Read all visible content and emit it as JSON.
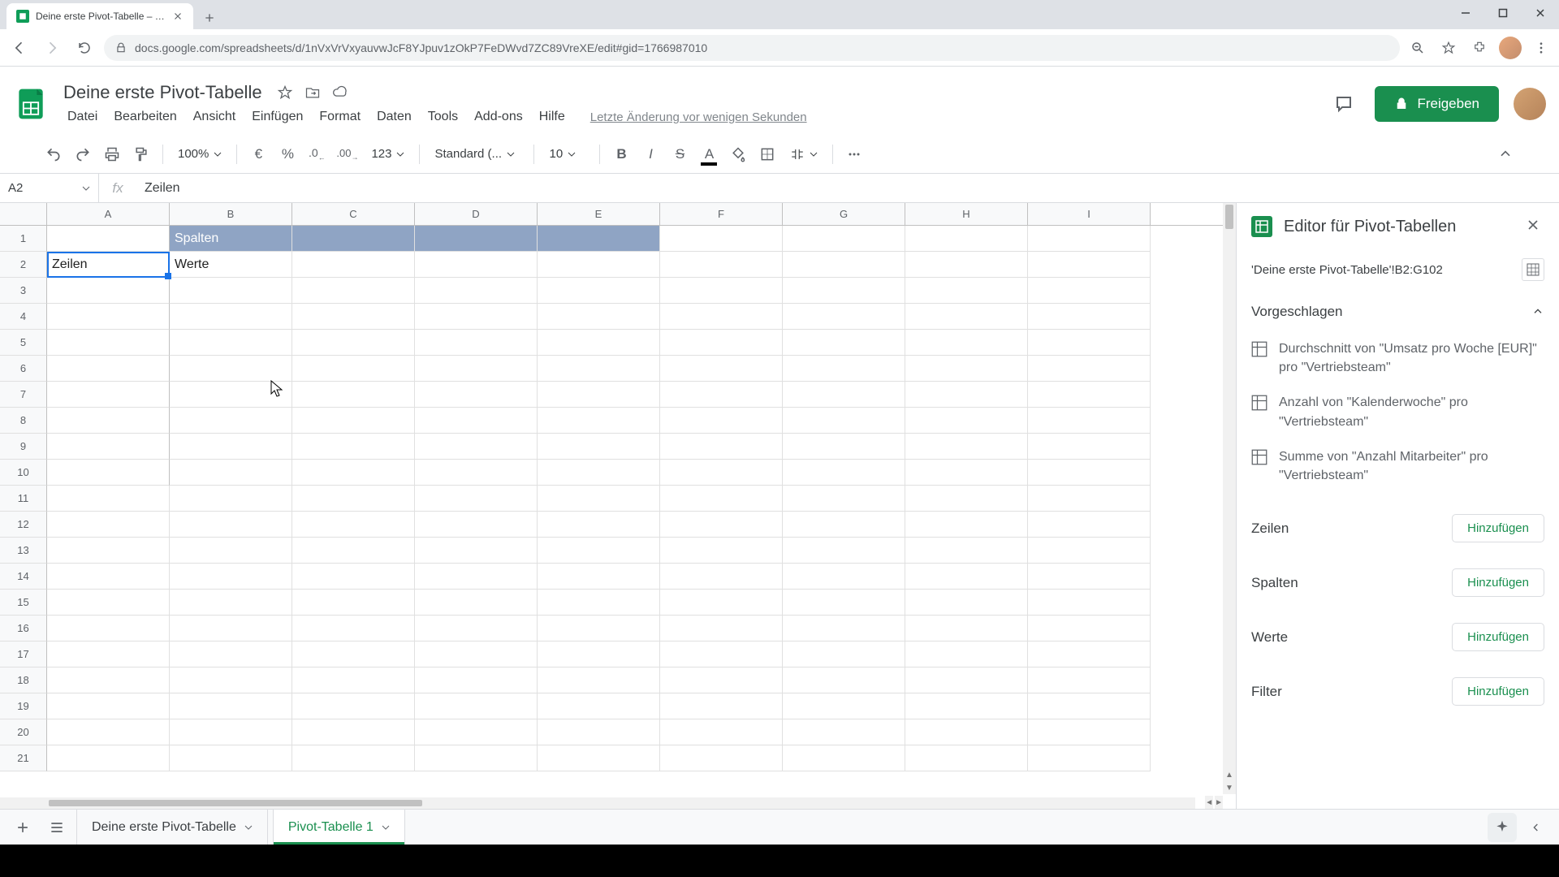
{
  "browser": {
    "tab_title": "Deine erste Pivot-Tabelle – Goog",
    "url": "docs.google.com/spreadsheets/d/1nVxVrVxyauvwJcF8YJpuv1zOkP7FeDWvd7ZC89VreXE/edit#gid=1766987010"
  },
  "header": {
    "doc_title": "Deine erste Pivot-Tabelle",
    "menu": {
      "file": "Datei",
      "edit": "Bearbeiten",
      "view": "Ansicht",
      "insert": "Einfügen",
      "format": "Format",
      "data": "Daten",
      "tools": "Tools",
      "addons": "Add-ons",
      "help": "Hilfe"
    },
    "last_change": "Letzte Änderung vor wenigen Sekunden",
    "share": "Freigeben"
  },
  "toolbar": {
    "zoom": "100%",
    "currency": "€",
    "percent": "%",
    "dec_dec": ".0",
    "inc_dec": ".00",
    "numfmt": "123",
    "font": "Standard (...",
    "font_size": "10"
  },
  "formula_bar": {
    "cell_ref": "A2",
    "content": "Zeilen"
  },
  "grid": {
    "columns": [
      "A",
      "B",
      "C",
      "D",
      "E",
      "F",
      "G",
      "H",
      "I"
    ],
    "rows": [
      "1",
      "2",
      "3",
      "4",
      "5",
      "6",
      "7",
      "8",
      "9",
      "10",
      "11",
      "12",
      "13",
      "14",
      "15",
      "16",
      "17",
      "18",
      "19",
      "20",
      "21"
    ],
    "cells": {
      "B1": "Spalten",
      "A2": "Zeilen",
      "B2": "Werte"
    }
  },
  "pivot_editor": {
    "title": "Editor für Pivot-Tabellen",
    "range": "'Deine erste Pivot-Tabelle'!B2:G102",
    "suggested_label": "Vorgeschlagen",
    "suggestions": [
      "Durchschnitt von \"Umsatz pro Woche [EUR]\" pro \"Vertriebsteam\"",
      "Anzahl von \"Kalenderwoche\" pro \"Vertriebsteam\"",
      "Summe von \"Anzahl Mitarbeiter\" pro \"Vertriebsteam\""
    ],
    "rows_label": "Zeilen",
    "cols_label": "Spalten",
    "values_label": "Werte",
    "filter_label": "Filter",
    "add_label": "Hinzufügen"
  },
  "sheets": {
    "tab1": "Deine erste Pivot-Tabelle",
    "tab2": "Pivot-Tabelle 1"
  }
}
